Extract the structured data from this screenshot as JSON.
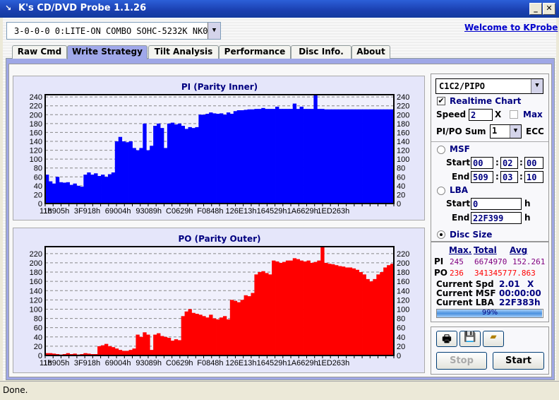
{
  "window": {
    "title": "K's CD/DVD Probe 1.1.26"
  },
  "device": {
    "selected": "3-0-0-0 0:LITE-ON COMBO SOHC-5232K NK07"
  },
  "welcome_link": "Welcome to KProbe",
  "tabs": [
    {
      "label": "Raw Cmd"
    },
    {
      "label": "Write Strategy",
      "active": true
    },
    {
      "label": "Tilt Analysis"
    },
    {
      "label": "Performance"
    },
    {
      "label": "Disc Info."
    },
    {
      "label": "About"
    }
  ],
  "settings": {
    "mode": "C1C2/PIPO",
    "realtime_label": "Realtime Chart",
    "realtime_checked": true,
    "speed_label": "Speed",
    "speed": "2",
    "speed_unit": "X",
    "max_label": "Max",
    "max_checked": false,
    "sum_label": "PI/PO Sum",
    "sum": "1",
    "ecc_label": "ECC",
    "msf_label": "MSF",
    "start_label": "Start",
    "end_label": "End",
    "msf_start": [
      "00",
      "02",
      "00"
    ],
    "msf_end": [
      "509",
      "03",
      "10"
    ],
    "colon": ":",
    "lba_label": "LBA",
    "lba_start": "0",
    "lba_end": "22F399",
    "h": "h",
    "disc_size_label": "Disc Size",
    "selected_range": "Disc Size"
  },
  "stats": {
    "headers": [
      "Max.",
      "Total",
      "Avg"
    ],
    "pi": {
      "label": "PI",
      "max": "245",
      "total": "6674970",
      "avg": "152.261"
    },
    "po": {
      "label": "PO",
      "max": "236",
      "total": "3413457",
      "avg": "77.863"
    },
    "spd_label": "Current Spd",
    "spd": "2.01",
    "spd_unit": "X",
    "msf_label": "Current MSF",
    "msf": "00:00:00",
    "lba_label": "Current LBA",
    "lba": "22F383h",
    "progress_text": "99%",
    "progress": 0.99
  },
  "buttons": {
    "stop": "Stop",
    "start": "Start",
    "icons": [
      "printer-icon",
      "save-icon",
      "open-folder-icon"
    ]
  },
  "status": "Done.",
  "chart_data": [
    {
      "type": "bar",
      "title": "PI (Parity Inner)",
      "color": "#0000ff",
      "ylim": [
        0,
        245
      ],
      "yticks": [
        0,
        20,
        40,
        60,
        80,
        100,
        120,
        140,
        160,
        180,
        200,
        220,
        240
      ],
      "xticklabels": [
        "11h",
        "18905h",
        "3F918h",
        "69004h",
        "93089h",
        "C0629h",
        "F0848h",
        "126E13h",
        "164529h",
        "1A6629h",
        "1ED263h"
      ],
      "grid": "horizontal dashed",
      "axes": "left and right",
      "values": [
        65,
        50,
        45,
        60,
        48,
        47,
        48,
        42,
        45,
        40,
        38,
        65,
        70,
        65,
        68,
        62,
        65,
        60,
        66,
        70,
        140,
        150,
        140,
        138,
        140,
        125,
        120,
        125,
        180,
        120,
        130,
        175,
        180,
        170,
        125,
        180,
        182,
        178,
        180,
        175,
        168,
        172,
        170,
        172,
        200,
        200,
        202,
        205,
        203,
        202,
        203,
        200,
        205,
        202,
        208,
        210,
        210,
        211,
        212,
        212,
        213,
        213,
        215,
        213,
        213,
        213,
        218,
        213,
        213,
        213,
        213,
        225,
        213,
        218,
        213,
        213,
        213,
        245,
        213,
        213,
        212,
        212,
        212,
        212,
        212,
        212,
        212,
        212,
        212,
        212,
        212,
        212,
        212,
        212,
        212,
        212,
        212,
        212,
        212,
        212
      ]
    },
    {
      "type": "bar",
      "title": "PO (Parity Outer)",
      "color": "#ff0000",
      "ylim": [
        0,
        235
      ],
      "yticks": [
        0,
        20,
        40,
        60,
        80,
        100,
        120,
        140,
        160,
        180,
        200,
        220
      ],
      "xticklabels": [
        "11h",
        "18905h",
        "3F918h",
        "69004h",
        "93089h",
        "C0629h",
        "F0848h",
        "126E13h",
        "164529h",
        "1A6629h",
        "1ED263h"
      ],
      "grid": "horizontal dashed",
      "axes": "left and right",
      "values": [
        5,
        5,
        4,
        3,
        2,
        3,
        5,
        3,
        4,
        2,
        3,
        5,
        4,
        3,
        3,
        20,
        22,
        25,
        20,
        18,
        15,
        12,
        10,
        10,
        12,
        15,
        45,
        40,
        50,
        45,
        12,
        45,
        48,
        42,
        40,
        38,
        32,
        35,
        33,
        85,
        95,
        100,
        92,
        90,
        88,
        85,
        82,
        88,
        80,
        78,
        82,
        85,
        78,
        120,
        118,
        115,
        120,
        130,
        128,
        135,
        175,
        180,
        182,
        178,
        175,
        205,
        203,
        200,
        202,
        205,
        205,
        210,
        208,
        205,
        203,
        205,
        200,
        202,
        205,
        236,
        200,
        198,
        197,
        195,
        193,
        192,
        190,
        190,
        188,
        185,
        180,
        175,
        165,
        160,
        165,
        175,
        180,
        190,
        195,
        198
      ]
    }
  ]
}
